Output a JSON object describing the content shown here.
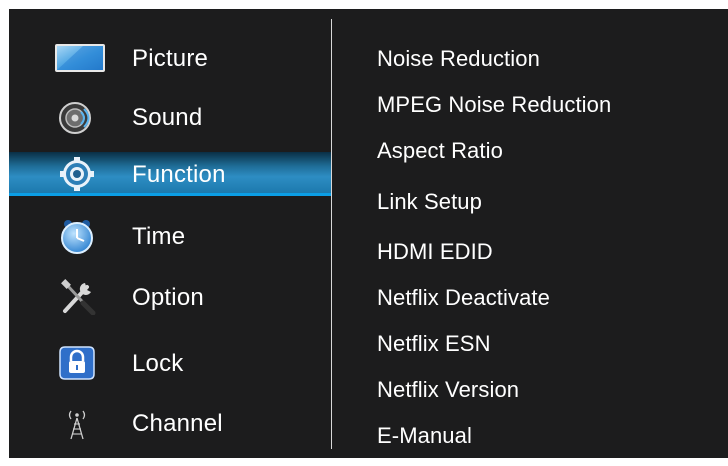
{
  "main_menu": [
    {
      "label": "Picture",
      "icon": "picture-icon",
      "selected": false
    },
    {
      "label": "Sound",
      "icon": "sound-icon",
      "selected": false
    },
    {
      "label": "Function",
      "icon": "gear-icon",
      "selected": true
    },
    {
      "label": "Time",
      "icon": "clock-icon",
      "selected": false
    },
    {
      "label": "Option",
      "icon": "tools-icon",
      "selected": false
    },
    {
      "label": "Lock",
      "icon": "lock-icon",
      "selected": false
    },
    {
      "label": "Channel",
      "icon": "antenna-icon",
      "selected": false
    }
  ],
  "function_submenu": [
    {
      "label": "Noise Reduction"
    },
    {
      "label": "MPEG Noise Reduction"
    },
    {
      "label": "Aspect Ratio"
    },
    {
      "label": "Link Setup"
    },
    {
      "label": "HDMI EDID"
    },
    {
      "label": "Netflix Deactivate"
    },
    {
      "label": "Netflix ESN"
    },
    {
      "label": "Netflix Version"
    },
    {
      "label": "E-Manual"
    }
  ],
  "colors": {
    "background": "#1c1c1d",
    "highlight": "#2d8dc3",
    "text": "#ffffff"
  }
}
